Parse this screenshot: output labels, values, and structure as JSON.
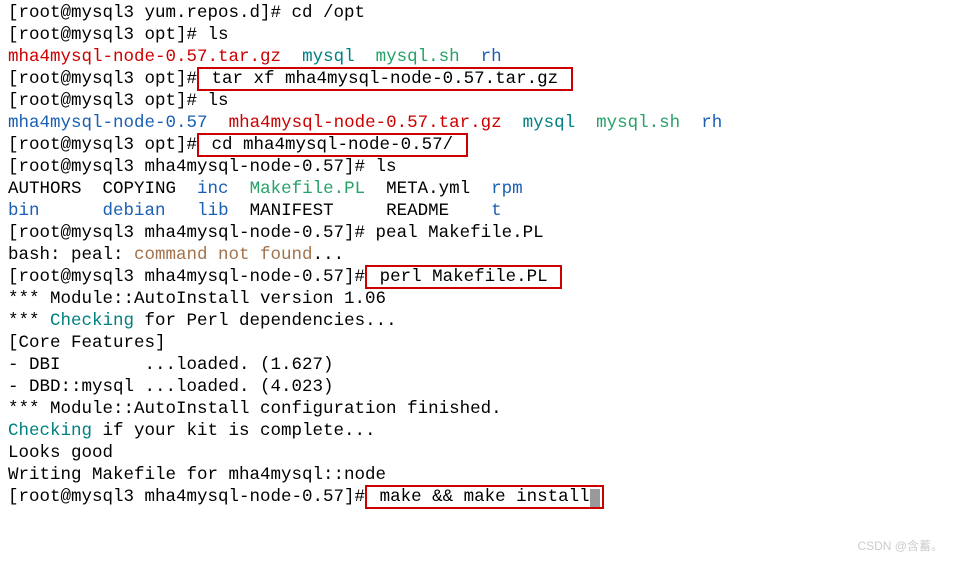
{
  "lines": [
    {
      "type": "plain",
      "text": "[root@mysql3 yum.repos.d]# cd /opt"
    },
    {
      "type": "plain",
      "text": "[root@mysql3 opt]# ls"
    },
    {
      "type": "ls1",
      "file1": "mha4mysql-node-0.57.tar.gz",
      "file2": "mysql",
      "file3": "mysql.sh",
      "file4": "rh"
    },
    {
      "type": "cmd_boxed",
      "prompt": "[root@mysql3 opt]#",
      "cmd": " tar xf mha4mysql-node-0.57.tar.gz "
    },
    {
      "type": "plain",
      "text": "[root@mysql3 opt]# ls"
    },
    {
      "type": "ls2",
      "f1": "mha4mysql-node-0.57",
      "f2": "mha4mysql-node-0.57.tar.gz",
      "f3": "mysql",
      "f4": "mysql.sh",
      "f5": "rh"
    },
    {
      "type": "cmd_boxed",
      "prompt": "[root@mysql3 opt]#",
      "cmd": " cd mha4mysql-node-0.57/ "
    },
    {
      "type": "plain",
      "text": "[root@mysql3 mha4mysql-node-0.57]# ls"
    },
    {
      "type": "ls3_row1",
      "c1": "AUTHORS",
      "c2": "COPYING",
      "c3": "inc",
      "c4": "Makefile.PL",
      "c5": "META.yml",
      "c6": "rpm"
    },
    {
      "type": "ls3_row2",
      "c1": "bin",
      "c2": "debian",
      "c3": "lib",
      "c4": "MANIFEST",
      "c5": "README",
      "c6": "t"
    },
    {
      "type": "plain",
      "text": "[root@mysql3 mha4mysql-node-0.57]# peal Makefile.PL"
    },
    {
      "type": "bash_err",
      "p1": "bash: peal: ",
      "p2": "command not found",
      "p3": "..."
    },
    {
      "type": "cmd_boxed2",
      "prompt": "[root@mysql3 mha4mysql-node-0.57]#",
      "cmd": " perl Makefile.PL "
    },
    {
      "type": "plain",
      "text": "*** Module::AutoInstall version 1.06"
    },
    {
      "type": "checking1",
      "p1": "*** ",
      "p2": "Checking",
      "p3": " for Perl dependencies..."
    },
    {
      "type": "plain",
      "text": "[Core Features]"
    },
    {
      "type": "plain",
      "text": "- DBI        ...loaded. (1.627)"
    },
    {
      "type": "plain",
      "text": "- DBD::mysql ...loaded. (4.023)"
    },
    {
      "type": "plain",
      "text": "*** Module::AutoInstall configuration finished."
    },
    {
      "type": "checking2",
      "p1": "Checking",
      "p2": " if your kit is complete..."
    },
    {
      "type": "plain",
      "text": "Looks good"
    },
    {
      "type": "plain",
      "text": "Writing Makefile for mha4mysql::node"
    },
    {
      "type": "cmd_boxed_cursor",
      "prompt": "[root@mysql3 mha4mysql-node-0.57]#",
      "cmd": " make && make install"
    }
  ],
  "watermark": "CSDN @含蓄。"
}
